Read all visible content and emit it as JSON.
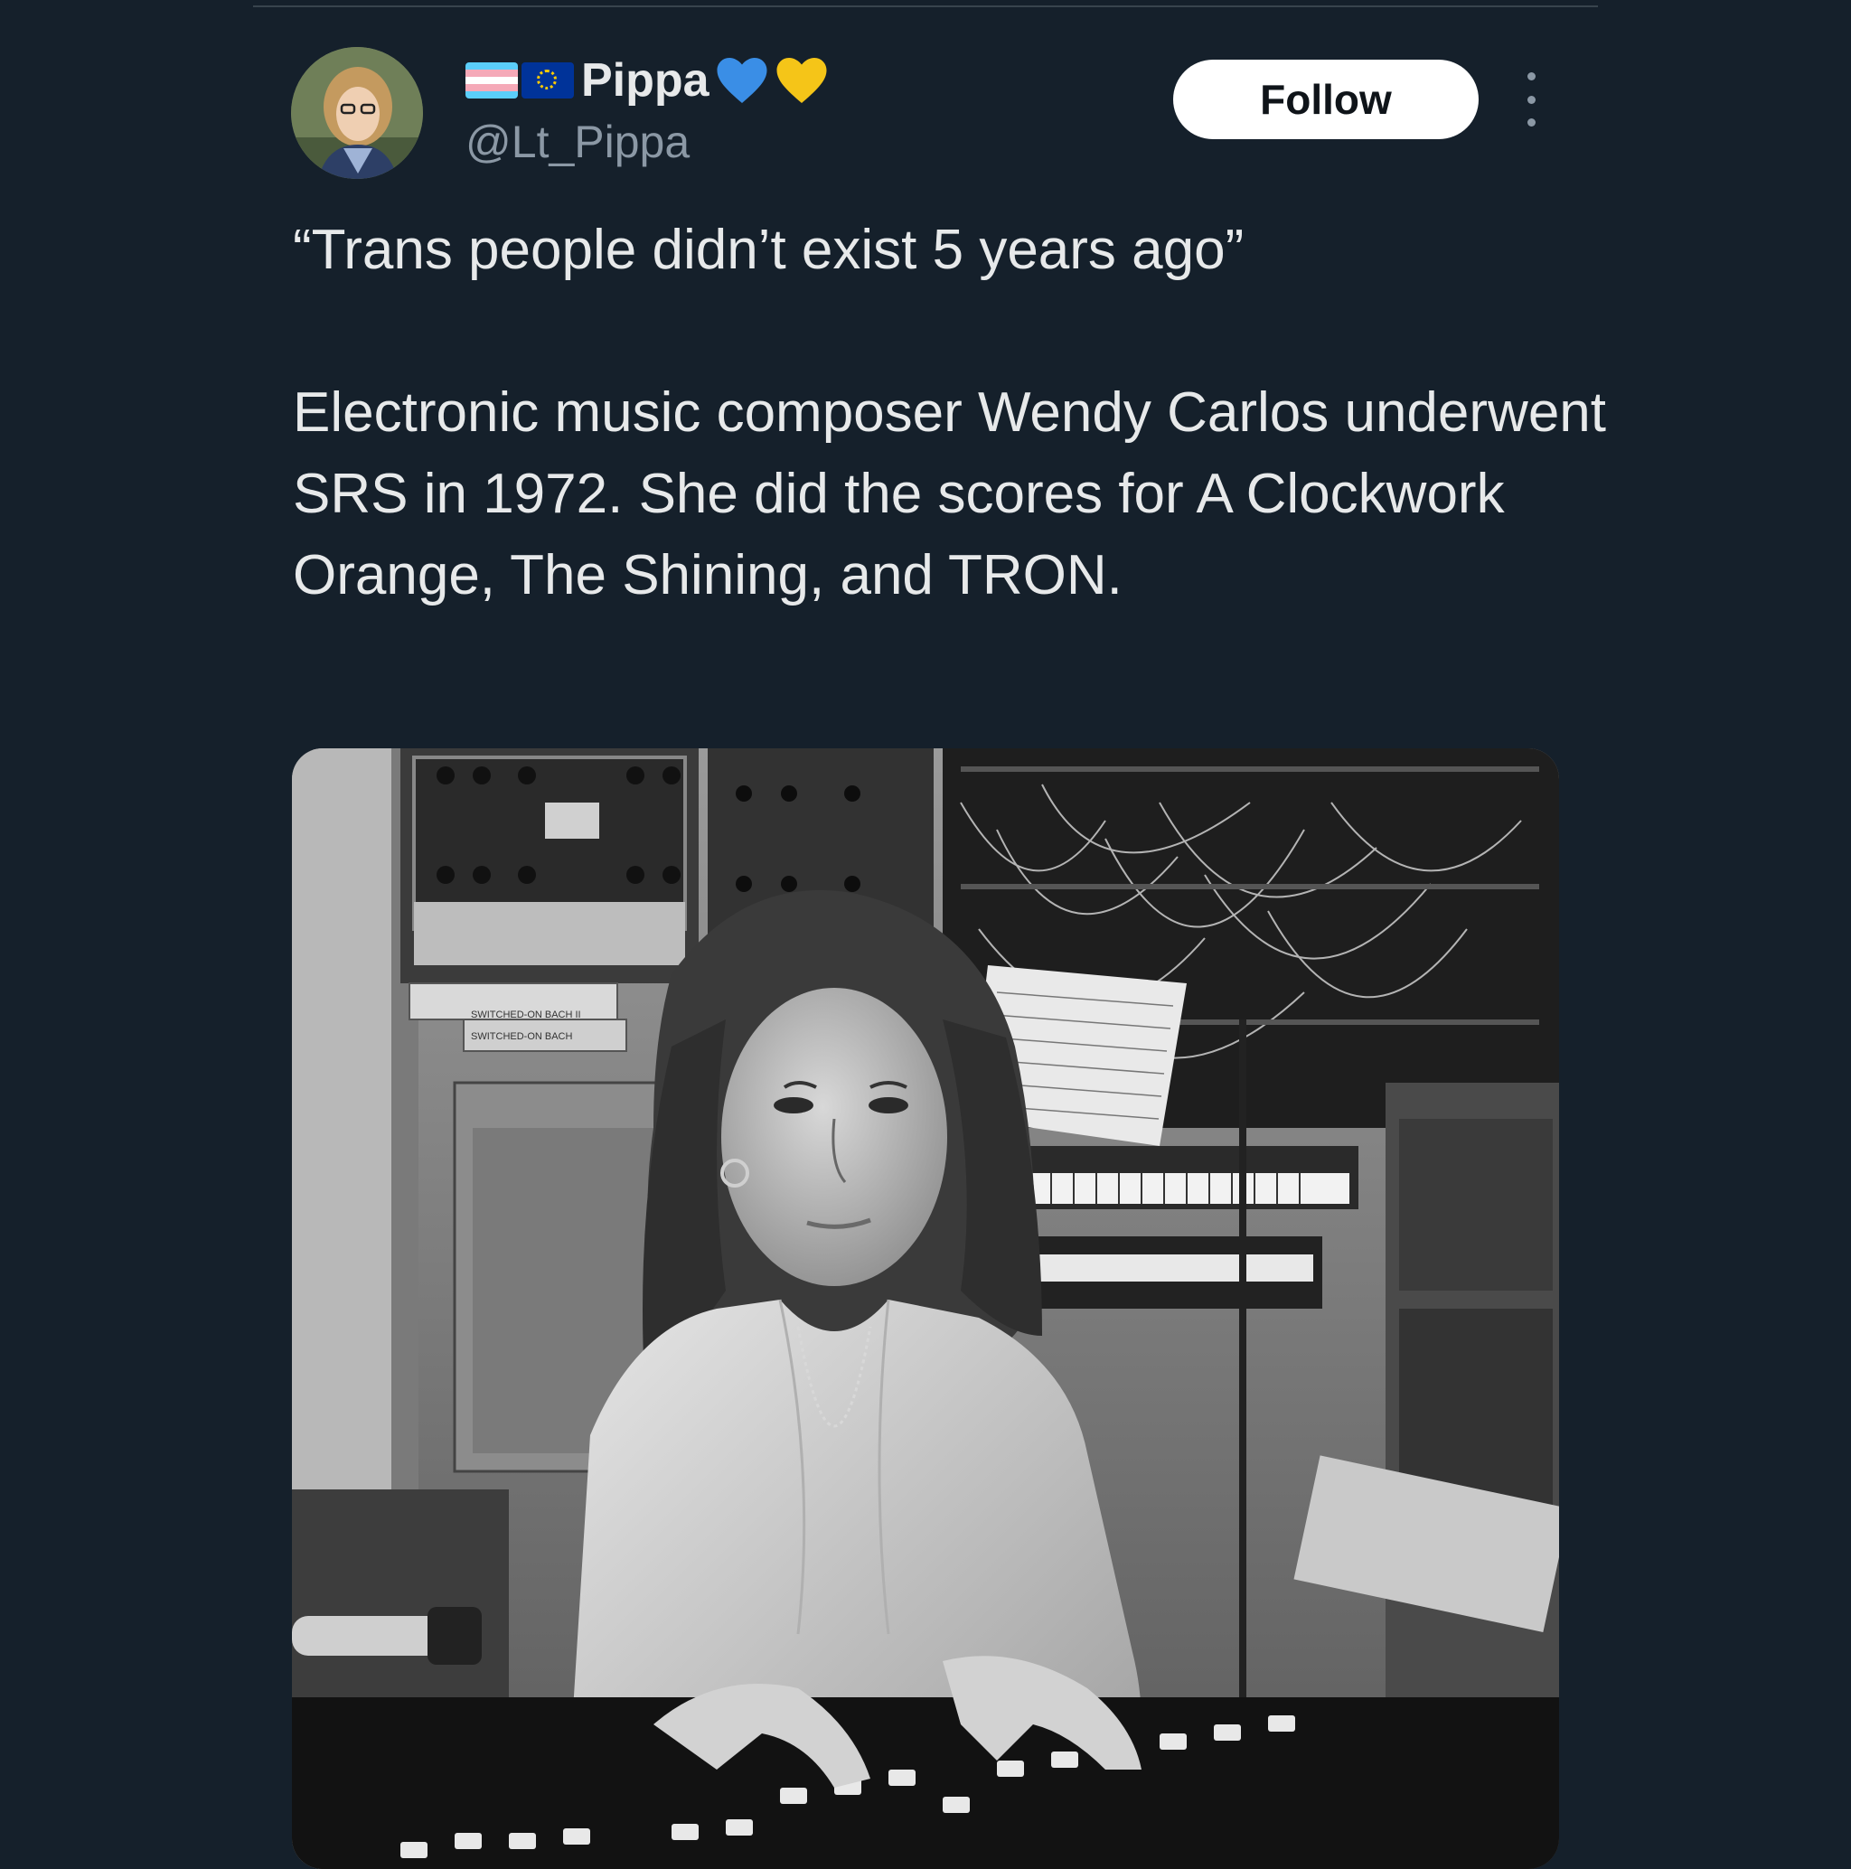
{
  "tweet": {
    "author": {
      "display_name": "Pippa",
      "handle": "@Lt_Pippa",
      "name_flags": [
        "trans-flag-icon",
        "eu-flag-icon"
      ],
      "name_hearts": [
        "blue-heart-icon",
        "yellow-heart-icon"
      ]
    },
    "follow_label": "Follow",
    "text_paragraphs": [
      "“Trans people didn’t exist 5 years ago”",
      "Electronic music composer Wendy Carlos underwent SRS in 1972. She did the scores for A Clockwork Orange, The Shining, and TRON."
    ],
    "media": {
      "kind": "black-and-white photo",
      "tape_box_labels": [
        "SWITCHED-ON BACH",
        "SWITCHED-ON BACH II"
      ]
    }
  },
  "colors": {
    "background": "#15202b",
    "text_primary": "#e7e9ea",
    "text_secondary": "#8b98a5",
    "follow_bg": "#ffffff",
    "follow_text": "#0f1419",
    "heart_blue": "#3a8ee6",
    "heart_yellow": "#f5c518"
  }
}
